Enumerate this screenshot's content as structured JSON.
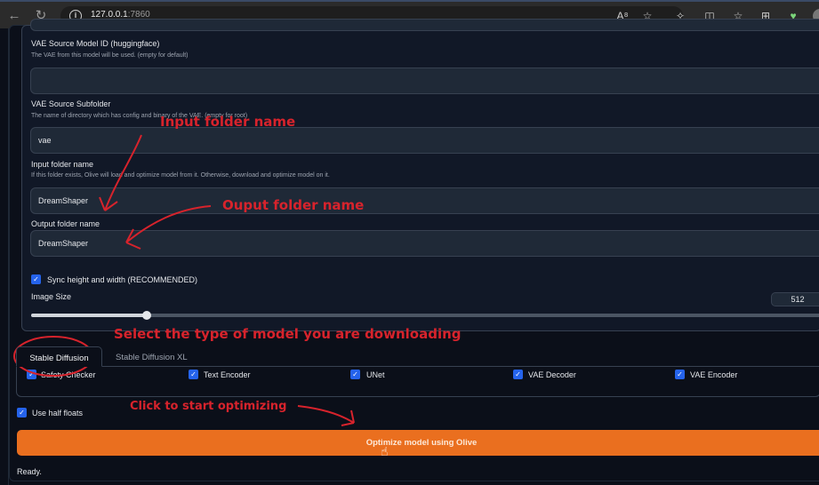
{
  "browser": {
    "url_host": "127.0.0.1",
    "url_port": ":7860",
    "icons": [
      "back-icon",
      "reload-icon",
      "site-info-icon",
      "read-aloud-icon",
      "favorite-icon",
      "extensions-icon",
      "split-screen-icon",
      "favorites-icon",
      "collections-icon",
      "browser-essentials-icon",
      "profile-avatar"
    ]
  },
  "form": {
    "vae_source_model": {
      "label": "VAE Source Model ID (huggingface)",
      "description": "The VAE from this model will be used. (empty for default)",
      "value": ""
    },
    "vae_subfolder": {
      "label": "VAE Source Subfolder",
      "description": "The name of directory which has config and binary of the VAE. (empty for root)",
      "value": "vae"
    },
    "input_folder": {
      "label": "Input folder name",
      "description": "If this folder exists, Olive will load and optimize model from it. Otherwise, download and optimize model on it.",
      "value": "DreamShaper"
    },
    "output_folder": {
      "label": "Output folder name",
      "value": "DreamShaper"
    },
    "sync_hw": {
      "label": "Sync height and width (RECOMMENDED)",
      "checked": true
    },
    "image_size": {
      "label": "Image Size",
      "value": "512",
      "fraction": 0.146
    }
  },
  "tabs": [
    {
      "label": "Stable Diffusion",
      "active": true
    },
    {
      "label": "Stable Diffusion XL",
      "active": false
    }
  ],
  "components": [
    {
      "label": "Safety Checker",
      "checked": true
    },
    {
      "label": "Text Encoder",
      "checked": true
    },
    {
      "label": "UNet",
      "checked": true
    },
    {
      "label": "VAE Decoder",
      "checked": true
    },
    {
      "label": "VAE Encoder",
      "checked": true
    }
  ],
  "half_floats": {
    "label": "Use half floats",
    "checked": true
  },
  "optimize_button": {
    "label": "Optimize model using Olive",
    "color": "#ea6f1f"
  },
  "status": "Ready.",
  "annotations": {
    "input_folder": "Input folder name",
    "output_folder": "Ouput folder name",
    "model_type": "Select the type of model you are downloading",
    "click": "Click to start optimizing",
    "color": "#d7232c"
  }
}
